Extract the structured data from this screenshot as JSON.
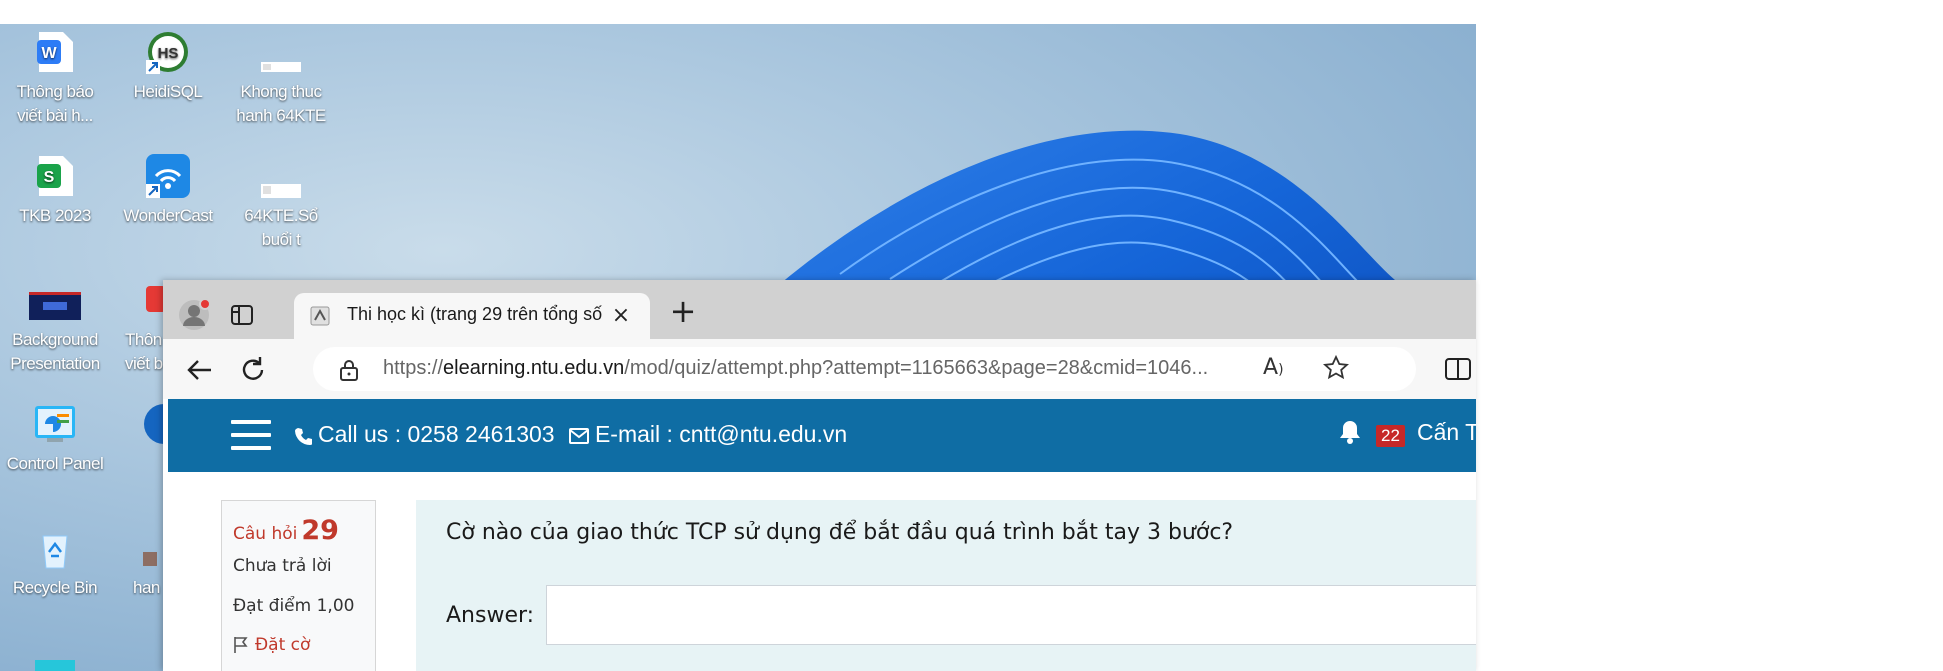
{
  "desktop": {
    "icons": [
      {
        "label": "Thông báo viết bài h...",
        "icon": "wps-writer-icon"
      },
      {
        "label": "HeidiSQL",
        "icon": "heidisql-icon"
      },
      {
        "label": "Khong thuc hanh 64KTE",
        "icon": "document-icon"
      },
      {
        "label": "TKB 2023",
        "icon": "wps-spreadsheet-icon"
      },
      {
        "label": "WonderCast",
        "icon": "wondercast-icon"
      },
      {
        "label": "64KTE.Sổ buổi t",
        "icon": "document-icon"
      },
      {
        "label": "Background Presentation",
        "icon": "presentation-icon"
      },
      {
        "label": "Thôn viết b",
        "icon": "app-icon"
      },
      {
        "label": "Control Panel",
        "icon": "control-panel-icon"
      },
      {
        "label": "Recycle Bin",
        "icon": "recycle-bin-icon"
      },
      {
        "label": "han",
        "icon": "app-icon"
      }
    ]
  },
  "browser": {
    "tab_title": "Thi học kì (trang 29 trên tổng số",
    "url_prefix": "https://",
    "url_host": "elearning.ntu.edu.vn",
    "url_path": "/mod/quiz/attempt.php?attempt=1165663&page=28&cmid=1046..."
  },
  "navbar": {
    "phone": "Call us : 0258 2461303",
    "email": "E-mail : cntt@ntu.edu.vn",
    "notification_count": "22",
    "user_name": "Cấn T"
  },
  "question": {
    "label": "Câu hỏi",
    "number": "29",
    "state": "Chưa trả lời",
    "grade": "Đạt điểm 1,00",
    "flag": "Đặt cờ",
    "text": "Cờ nào của giao thức TCP sử dụng để bắt đầu quá trình bắt tay 3 bước?",
    "answer_label": "Answer:",
    "answer_value": ""
  }
}
